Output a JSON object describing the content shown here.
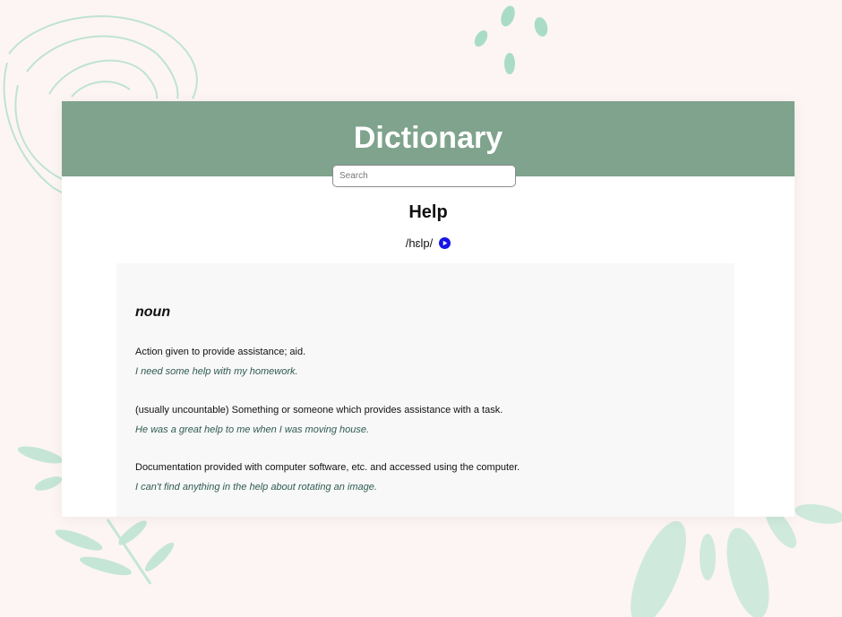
{
  "colors": {
    "background": "#fdf5f3",
    "header": "#7fa38d",
    "decor": "#a9dcc6",
    "play_button": "#1616e8",
    "example_text": "#2f5b52"
  },
  "header": {
    "title": "Dictionary"
  },
  "search": {
    "placeholder": "Search",
    "value": ""
  },
  "entry": {
    "word": "Help",
    "phonetic": "/hɛlp/",
    "play_icon": "play-circle-icon",
    "meanings": [
      {
        "part_of_speech": "noun",
        "definitions": [
          {
            "definition": "Action given to provide assistance; aid.",
            "example": "I need some help with my homework."
          },
          {
            "definition": "(usually uncountable) Something or someone which provides assistance with a task.",
            "example": "He was a great help to me when I was moving house."
          },
          {
            "definition": "Documentation provided with computer software, etc. and accessed using the computer.",
            "example": "I can't find anything in the help about rotating an image."
          }
        ]
      }
    ]
  }
}
